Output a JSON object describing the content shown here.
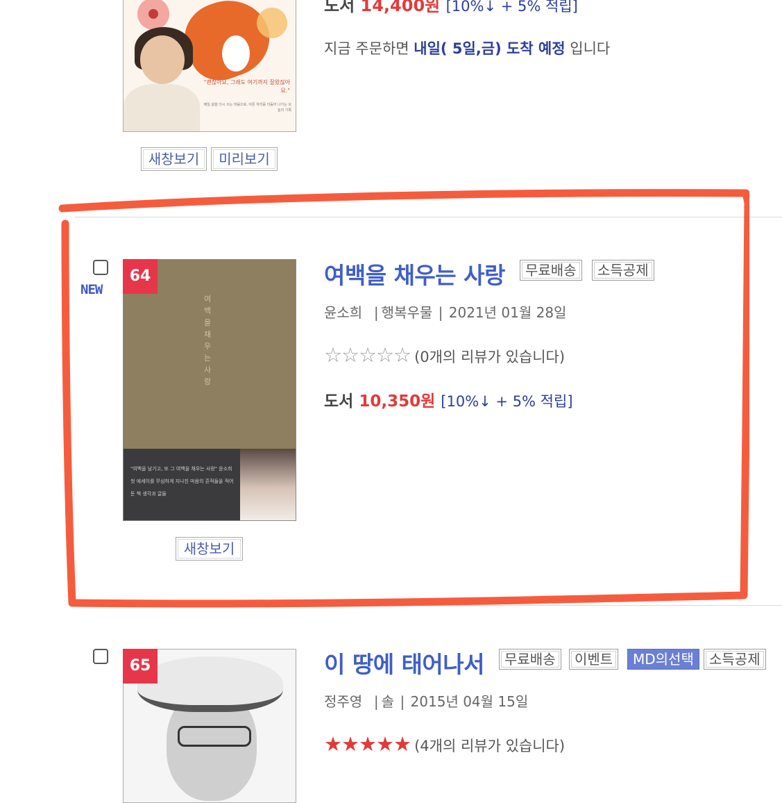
{
  "item_prev": {
    "price_prefix": "도서",
    "price": "14,400원",
    "discount": "[10%↓ + 5% 적립]",
    "arrival_prefix": "지금 주문하면",
    "arrival_highlight": "내일( 5일,금) 도착 예정",
    "arrival_suffix": "입니다",
    "cover_quote": "\"괜찮아요, 그래도 여기까지 잘왔잖아요.\"",
    "cover_small": "매일 삶을 다시 쓰는 마음으로, 아픈 자리를 더듬어 나가는 오늘의 기록",
    "btn_new_window": "새창보기",
    "btn_preview": "미리보기"
  },
  "item_64": {
    "rank": "64",
    "new_badge": "NEW",
    "title": "여백을 채우는 사랑",
    "tags": [
      "무료배송",
      "소득공제"
    ],
    "author": "윤소희",
    "publisher": "행복우물",
    "date": "2021년 01월 28일",
    "stars": "☆☆☆☆☆",
    "review": "(0개의 리뷰가 있습니다)",
    "price_prefix": "도서",
    "price": "10,350원",
    "discount": "[10%↓ + 5% 적립]",
    "btn_new_window": "새창보기",
    "cover_vtext": "여백을채우는사랑",
    "cover_small": "\"여백을 남기고, 또 그 여백을 채우는 사랑\" 윤소희 첫 에세이를 무심하게 지나친 마음의 흔적들을 적어둔 책 생각과 글들"
  },
  "item_65": {
    "rank": "65",
    "title": "이 땅에 태어나서",
    "tags": [
      "무료배송",
      "이벤트",
      "MD의선택",
      "소득공제"
    ],
    "author": "정주영",
    "publisher": "솔",
    "date": "2015년 04월 15일",
    "stars": "★★★★★",
    "review": "(4개의 리뷰가 있습니다)"
  },
  "colors": {
    "accent_blue": "#3f5ec9",
    "price_red": "#e23a3a",
    "rank_red": "#e7364a",
    "highlight_stroke": "#f4502f"
  }
}
